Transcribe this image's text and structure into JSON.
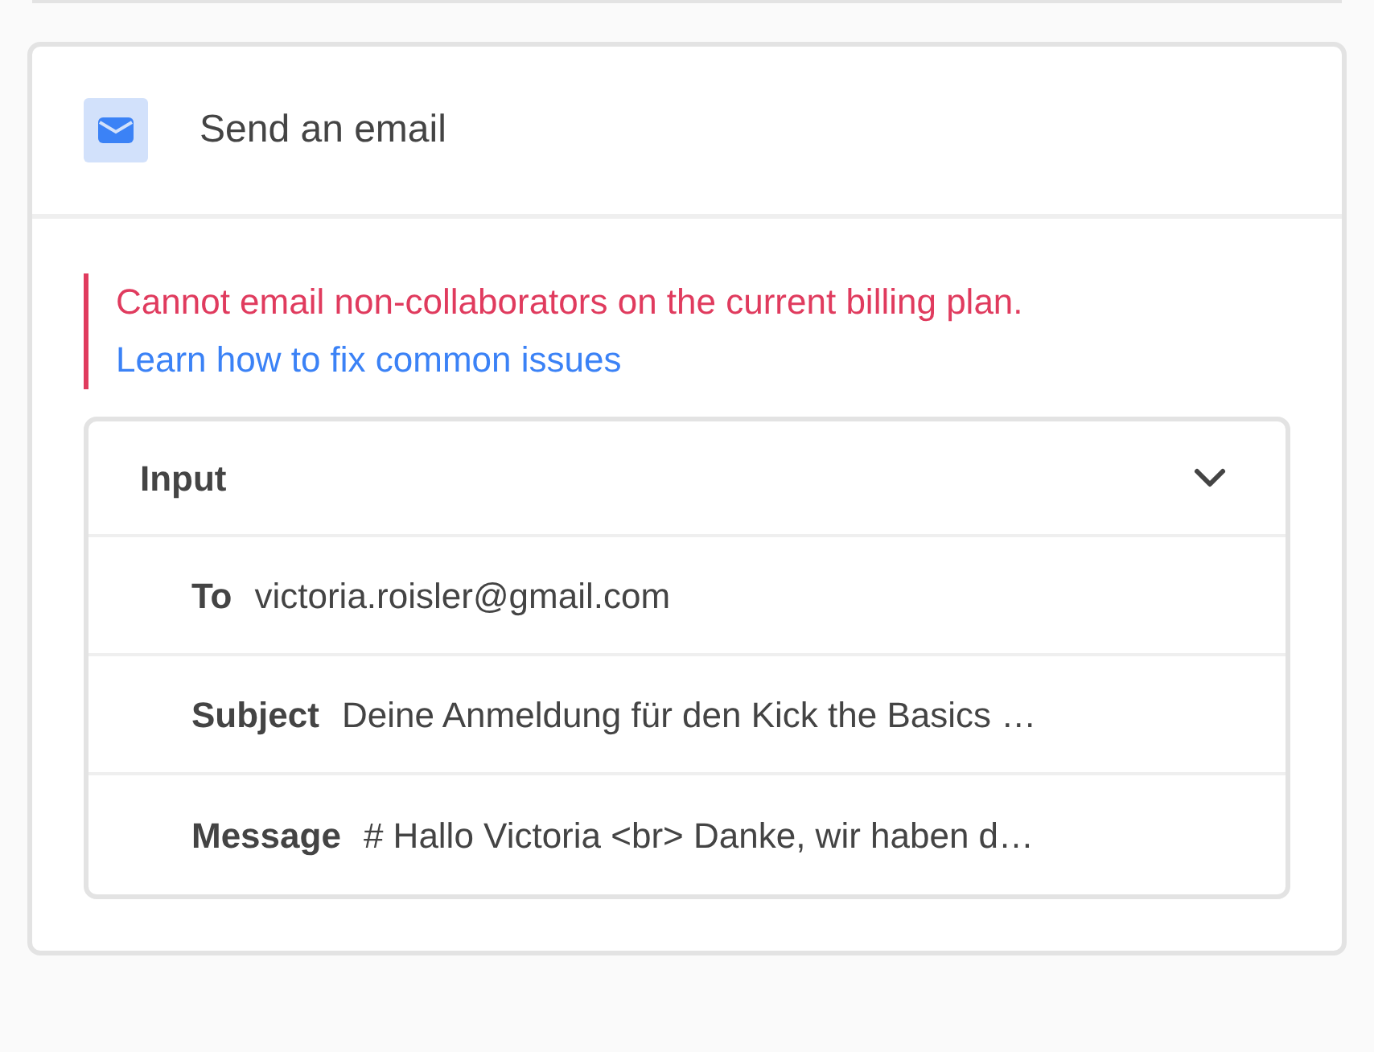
{
  "step": {
    "title": "Send an email"
  },
  "error": {
    "message": "Cannot email non-collaborators on the current billing plan.",
    "link": "Learn how to fix common issues"
  },
  "input": {
    "title": "Input",
    "expanded": true,
    "fields": [
      {
        "label": "To",
        "value": "victoria.roisler@gmail.com"
      },
      {
        "label": "Subject",
        "value": "Deine Anmeldung für den Kick the Basics …"
      },
      {
        "label": "Message",
        "value": "# Hallo Victoria <br> Danke, wir haben d…"
      }
    ]
  }
}
